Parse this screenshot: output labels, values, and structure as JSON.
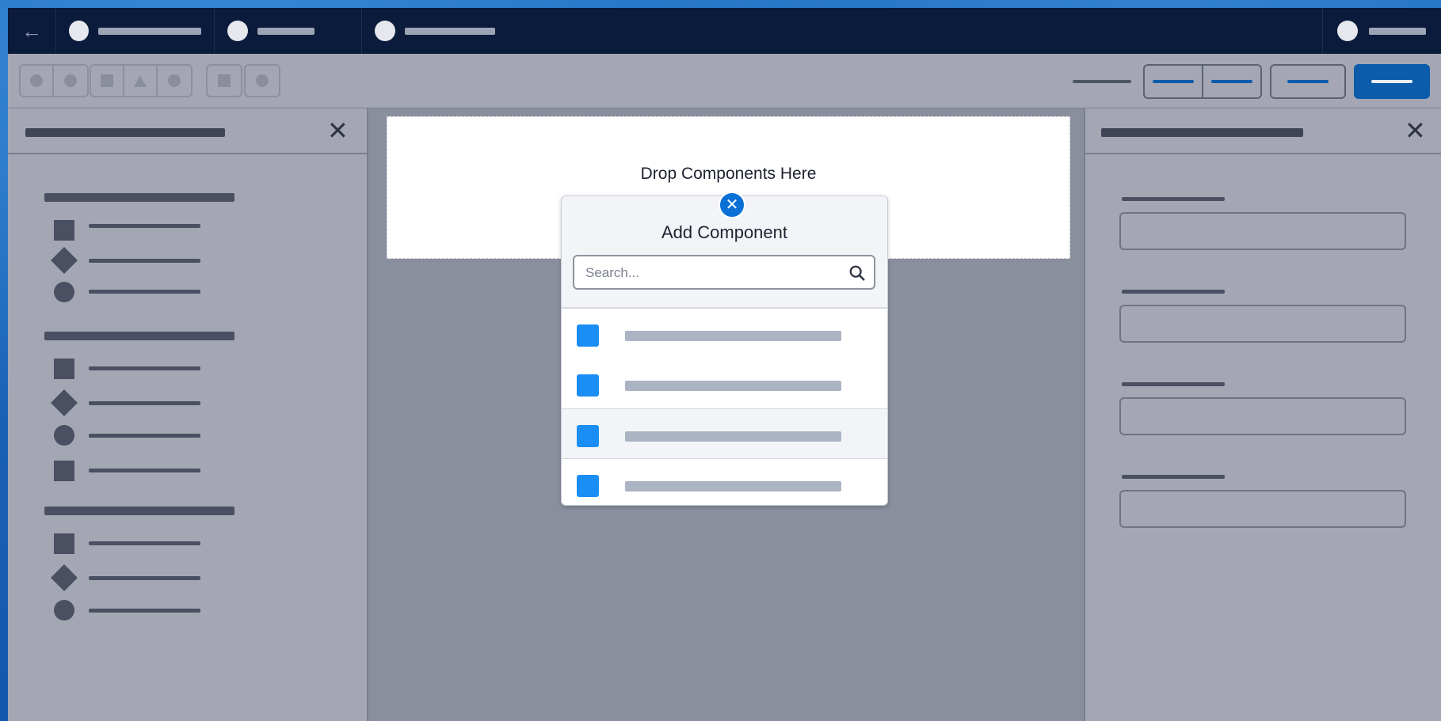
{
  "canvas": {
    "drop_text": "Drop Components Here"
  },
  "modal": {
    "title": "Add Component",
    "search_placeholder": "Search...",
    "close_glyph": "✕",
    "items_count_shown": 4,
    "item_icon_color": "#1b8ef5"
  },
  "nav": {
    "back_glyph": "←"
  },
  "panels": {
    "close_glyph": "✕"
  },
  "colors": {
    "accent": "#0b5cab",
    "navbar": "#0b1b3b"
  }
}
